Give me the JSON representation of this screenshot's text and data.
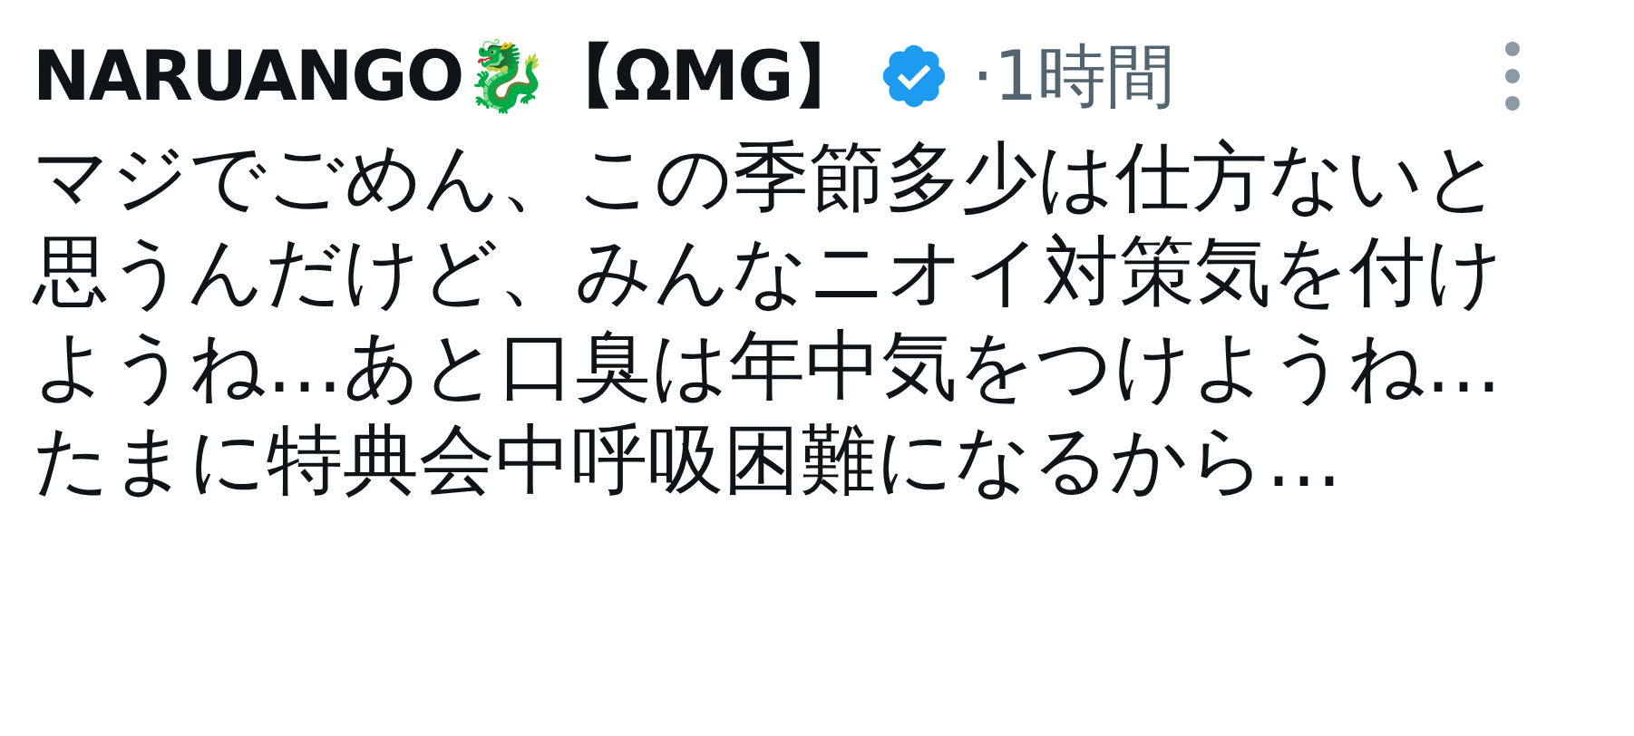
{
  "post": {
    "author": "NARUANGO🐉【ΩMG】",
    "verified": true,
    "time": "·1時間",
    "text": "マジでごめん、この季節多少は仕方ないと思うんだけど、みんなニオイ対策気を付けようね…あと口臭は年中気をつけようね…たまに特典会中呼吸困難になるから…"
  }
}
